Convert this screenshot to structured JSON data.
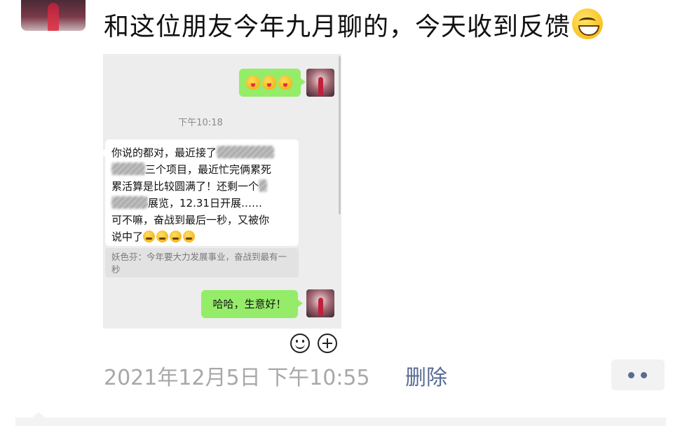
{
  "post": {
    "text": "和这位朋友今年九月聊的，今天收到反馈",
    "emoji": "grinning-face"
  },
  "chat": {
    "time": "下午10:18",
    "message_lines": [
      "你说的都对，最近接了",
      "三个项目，最近忙完俩累死",
      "累活算是比较圆满了！还剩一个",
      "展览，12.31日开展……",
      "可不嘛，奋战到最后一秒，又被你",
      "说中了"
    ],
    "quote": "妖色芬：今年要大力发展事业，奋战到最有一秒",
    "reply": "哈哈，生意好！"
  },
  "meta": {
    "date": "2021年12月5日 下午10:55",
    "delete_label": "删除"
  },
  "colors": {
    "link": "#576b95",
    "bubble_green": "#95ec69",
    "chat_bg": "#ededed"
  }
}
